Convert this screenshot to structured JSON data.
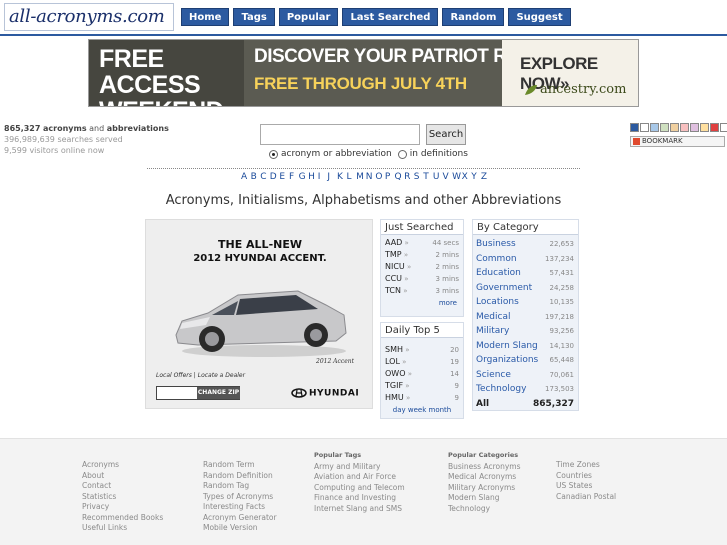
{
  "header": {
    "logo_text": "all-acronyms.com",
    "nav": [
      "Home",
      "Tags",
      "Popular",
      "Last Searched",
      "Random",
      "Suggest"
    ]
  },
  "banner": {
    "left_line1": "FREE ACCESS",
    "left_line2": "WEEKEND",
    "headline": "DISCOVER YOUR PATRIOT ROOTS",
    "subline": "FREE THROUGH JULY 4TH",
    "cta": "EXPLORE NOW»",
    "brand": "ancestry.com"
  },
  "stats": {
    "acronyms_count": "865,327",
    "acronyms_word": "acronyms",
    "and_word": "and",
    "abbrev_word": "abbreviations",
    "searches": "396,989,639 searches served",
    "visitors": "9,599 visitors online now"
  },
  "search": {
    "value": "",
    "button": "Search",
    "option1": "acronym or abbreviation",
    "option2": "in definitions"
  },
  "bookmark": {
    "label": "BOOKMARK"
  },
  "swatch_colors": [
    "#2c5aa0",
    "#ffffff",
    "#a8c8e8",
    "#cfe0c0",
    "#f0d0a0",
    "#f8c0c0",
    "#e0c0e0",
    "#ffe0a0",
    "#e04040",
    "#ffffff",
    "#ffffff"
  ],
  "alphabet": [
    "A",
    "B",
    "C",
    "D",
    "E",
    "F",
    "G",
    "H",
    "I",
    "J",
    "K",
    "L",
    "M",
    "N",
    "O",
    "P",
    "Q",
    "R",
    "S",
    "T",
    "U",
    "V",
    "W",
    "X",
    "Y",
    "Z"
  ],
  "main_heading": "Acronyms, Initialisms, Alphabetisms and other Abbreviations",
  "car_ad": {
    "line1": "THE ALL-NEW",
    "line2": "2012 HYUNDAI ACCENT.",
    "model": "2012 Accent",
    "links": "Local Offers  |  Locate a Dealer",
    "zip_button": "CHANGE ZIP",
    "brand": "HYUNDAI"
  },
  "just_searched": {
    "title": "Just Searched",
    "rows": [
      {
        "acr": "AAD",
        "time": "44 secs"
      },
      {
        "acr": "TMP",
        "time": "2 mins"
      },
      {
        "acr": "NICU",
        "time": "2 mins"
      },
      {
        "acr": "CCU",
        "time": "3 mins"
      },
      {
        "acr": "TCN",
        "time": "3 mins"
      }
    ],
    "more": "more"
  },
  "daily_top": {
    "title": "Daily Top 5",
    "rows": [
      {
        "acr": "SMH",
        "count": "20"
      },
      {
        "acr": "LOL",
        "count": "19"
      },
      {
        "acr": "OWO",
        "count": "14"
      },
      {
        "acr": "TGIF",
        "count": "9"
      },
      {
        "acr": "HMU",
        "count": "9"
      }
    ],
    "links": "day week month"
  },
  "by_category": {
    "title": "By Category",
    "rows": [
      {
        "name": "Business",
        "count": "22,653"
      },
      {
        "name": "Common",
        "count": "137,234"
      },
      {
        "name": "Education",
        "count": "57,431"
      },
      {
        "name": "Government",
        "count": "24,258"
      },
      {
        "name": "Locations",
        "count": "10,135"
      },
      {
        "name": "Medical",
        "count": "197,218"
      },
      {
        "name": "Military",
        "count": "93,256"
      },
      {
        "name": "Modern Slang",
        "count": "14,130"
      },
      {
        "name": "Organizations",
        "count": "65,448"
      },
      {
        "name": "Science",
        "count": "70,061"
      },
      {
        "name": "Technology",
        "count": "173,503"
      }
    ],
    "total_label": "All",
    "total_count": "865,327"
  },
  "footer": {
    "col1": [
      "Acronyms",
      "About",
      "Contact",
      "Statistics",
      "Privacy",
      "Recommended Books",
      "Useful Links"
    ],
    "col2": [
      "Random Term",
      "Random Definition",
      "Random Tag",
      "Types of Acronyms",
      "Interesting Facts",
      "Acronym Generator",
      "Mobile Version"
    ],
    "col3_title": "Popular Tags",
    "col3": [
      "Army and Military",
      "Aviation and Air Force",
      "Computing and Telecom",
      "Finance and Investing",
      "Internet Slang and SMS"
    ],
    "col4_title": "Popular Categories",
    "col4": [
      "Business Acronyms",
      "Medical Acronyms",
      "Military Acronyms",
      "Modern Slang",
      "Technology"
    ],
    "col5": [
      "Time Zones",
      "Countries",
      "US States",
      "Canadian Postal"
    ]
  }
}
